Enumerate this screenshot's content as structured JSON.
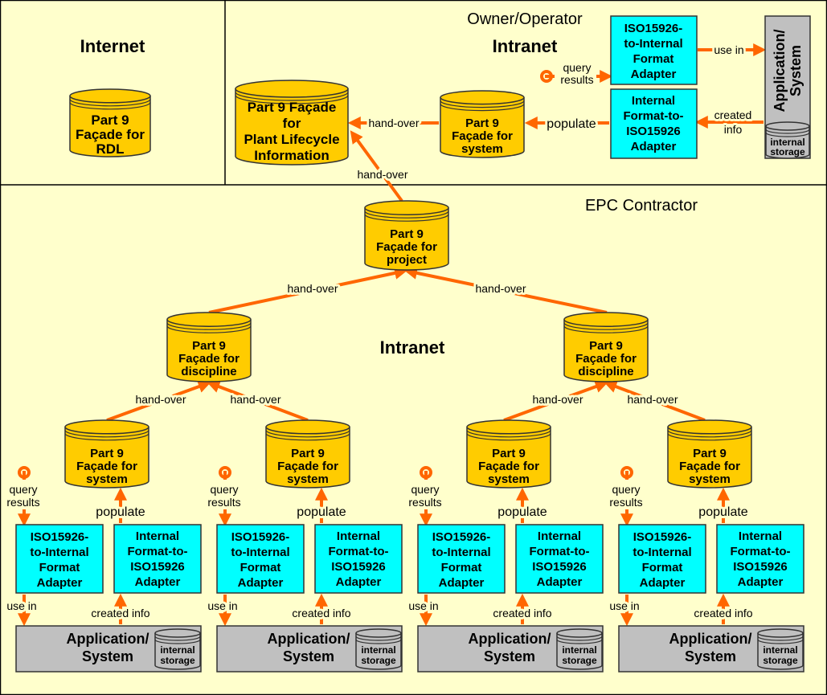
{
  "colors": {
    "background": "#FFFFCC",
    "facade": "#FFCC00",
    "adapter": "#00FFFF",
    "application": "#C0C0C0",
    "arrow": "#FF6600",
    "border": "#000000"
  },
  "regions": {
    "internet": "Internet",
    "owner": "Owner/Operator",
    "owner_intranet": "Intranet",
    "epc": "EPC Contractor",
    "epc_intranet": "Intranet"
  },
  "internet": {
    "rdl": [
      "Part 9",
      "Façade for",
      "RDL"
    ]
  },
  "owner": {
    "plant": [
      "Part 9 Façade",
      "for",
      "Plant Lifecycle",
      "Information"
    ],
    "system": [
      "Part 9",
      "Façade for",
      "system"
    ],
    "adapter_in": [
      "ISO15926-",
      "to-Internal",
      "Format",
      "Adapter"
    ],
    "adapter_out": [
      "Internal",
      "Format-to-",
      "ISO15926",
      "Adapter"
    ],
    "app": [
      "Application/",
      "System"
    ],
    "storage": [
      "internal",
      "storage"
    ],
    "query": [
      "query",
      "results"
    ],
    "use_in": "use in",
    "created": [
      "created",
      "info"
    ],
    "populate": "populate",
    "handover_plant": "hand-over",
    "handover_project": "hand-over"
  },
  "epc": {
    "project": [
      "Part 9",
      "Façade for",
      "project"
    ],
    "handover_left": "hand-over",
    "handover_right": "hand-over",
    "disciplines": [
      {
        "lines": [
          "Part 9",
          "Façade for",
          "discipline"
        ],
        "handovers": [
          "hand-over",
          "hand-over"
        ]
      },
      {
        "lines": [
          "Part 9",
          "Façade for",
          "discipline"
        ],
        "handovers": [
          "hand-over",
          "hand-over"
        ]
      }
    ],
    "groups": [
      {
        "system": [
          "Part 9",
          "Façade for",
          "system"
        ],
        "adapter_in": [
          "ISO15926-",
          "to-Internal",
          "Format",
          "Adapter"
        ],
        "adapter_out": [
          "Internal",
          "Format-to-",
          "ISO15926",
          "Adapter"
        ],
        "app": [
          "Application/",
          "System"
        ],
        "storage": [
          "internal",
          "storage"
        ],
        "query": [
          "query",
          "results"
        ],
        "populate": "populate",
        "use_in": "use in",
        "created": "created info"
      },
      {
        "system": [
          "Part 9",
          "Façade for",
          "system"
        ],
        "adapter_in": [
          "ISO15926-",
          "to-Internal",
          "Format",
          "Adapter"
        ],
        "adapter_out": [
          "Internal",
          "Format-to-",
          "ISO15926",
          "Adapter"
        ],
        "app": [
          "Application/",
          "System"
        ],
        "storage": [
          "internal",
          "storage"
        ],
        "query": [
          "query",
          "results"
        ],
        "populate": "populate",
        "use_in": "use in",
        "created": "created info"
      },
      {
        "system": [
          "Part 9",
          "Façade for",
          "system"
        ],
        "adapter_in": [
          "ISO15926-",
          "to-Internal",
          "Format",
          "Adapter"
        ],
        "adapter_out": [
          "Internal",
          "Format-to-",
          "ISO15926",
          "Adapter"
        ],
        "app": [
          "Application/",
          "System"
        ],
        "storage": [
          "internal",
          "storage"
        ],
        "query": [
          "query",
          "results"
        ],
        "populate": "populate",
        "use_in": "use in",
        "created": "created info"
      },
      {
        "system": [
          "Part 9",
          "Façade for",
          "system"
        ],
        "adapter_in": [
          "ISO15926-",
          "to-Internal",
          "Format",
          "Adapter"
        ],
        "adapter_out": [
          "Internal",
          "Format-to-",
          "ISO15926",
          "Adapter"
        ],
        "app": [
          "Application/",
          "System"
        ],
        "storage": [
          "internal",
          "storage"
        ],
        "query": [
          "query",
          "results"
        ],
        "populate": "populate",
        "use_in": "use in",
        "created": "created info"
      }
    ]
  }
}
